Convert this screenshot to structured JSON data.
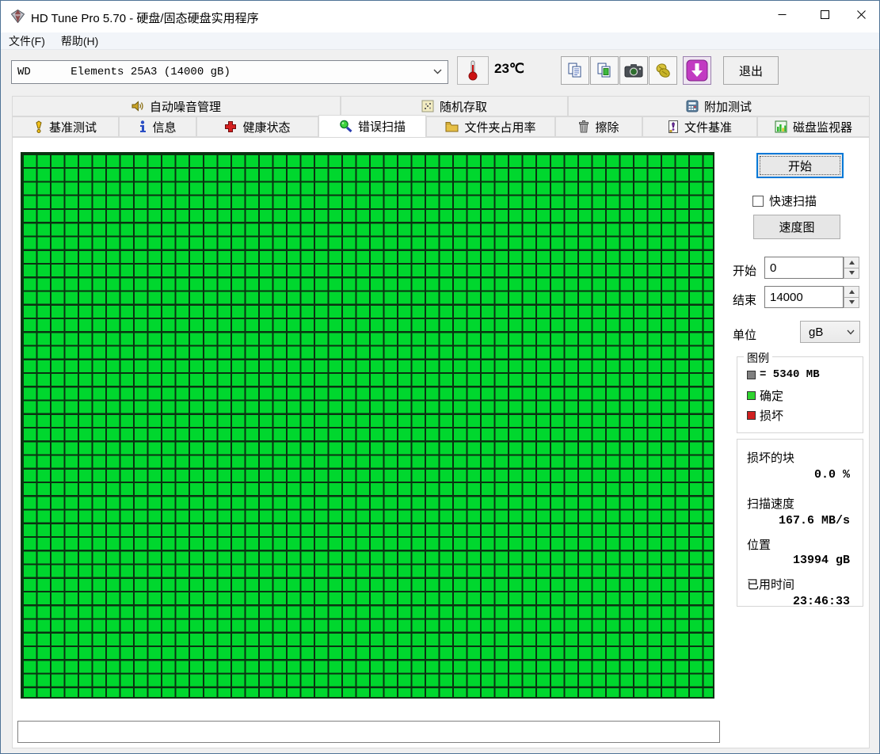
{
  "window": {
    "title": "HD Tune Pro 5.70 - 硬盘/固态硬盘实用程序"
  },
  "menu": {
    "items": [
      "文件(F)",
      "帮助(H)"
    ]
  },
  "toolbar": {
    "drive": "WD      Elements 25A3 (14000 gB)",
    "temperature": "23℃",
    "exit": "退出"
  },
  "tabs": {
    "row1": [
      "自动噪音管理",
      "随机存取",
      "附加测试"
    ],
    "row2": [
      "基准测试",
      "信息",
      "健康状态",
      "错误扫描",
      "文件夹占用率",
      "擦除",
      "文件基准",
      "磁盘监视器"
    ],
    "active": "错误扫描"
  },
  "scan": {
    "start_button": "开始",
    "quick_scan_label": "快速扫描",
    "speed_map_button": "速度图",
    "start_label": "开始",
    "start_value": "0",
    "end_label": "结束",
    "end_value": "14000",
    "unit_label": "单位",
    "unit_value": "gB",
    "grid": {
      "columns": 50,
      "rows": 40,
      "status": "all_ok"
    }
  },
  "legend": {
    "title": "图例",
    "block_size": "= 5340 MB",
    "ok_label": "确定",
    "bad_label": "损坏"
  },
  "stats": {
    "bad_blocks": {
      "label": "损坏的块",
      "value": "0.0 %"
    },
    "speed": {
      "label": "扫描速度",
      "value": "167.6 MB/s"
    },
    "position": {
      "label": "位置",
      "value": "13994 gB"
    },
    "elapsed": {
      "label": "已用时间",
      "value": "23:46:33"
    }
  },
  "colors": {
    "ok_green": "#00d72e",
    "bad_red": "#d02020",
    "block_gray": "#808080",
    "grid_line": "#0a3311",
    "update_accent": "#c23ac2",
    "focus_blue": "#0078d7"
  }
}
